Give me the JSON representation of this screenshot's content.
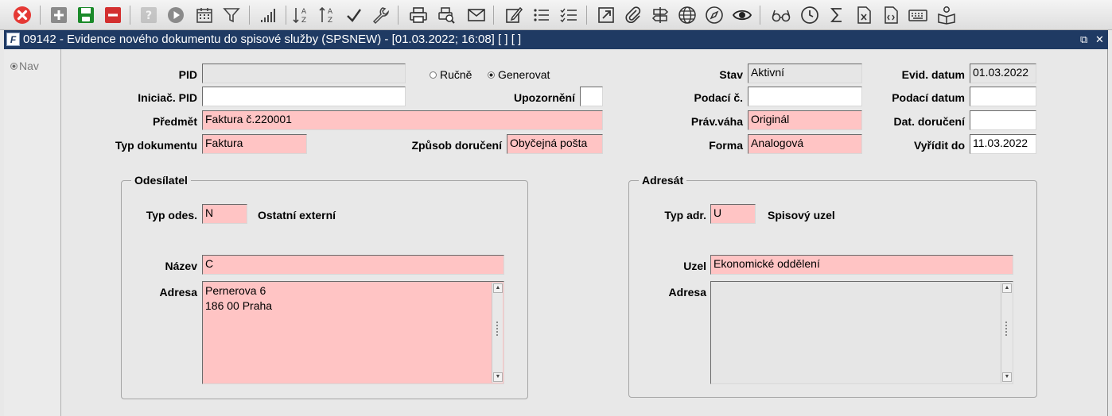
{
  "toolbar": {
    "icons": [
      "close-icon",
      "add-icon",
      "save-icon",
      "delete-icon",
      "help-icon",
      "play-icon",
      "calendar-icon",
      "filter-icon",
      "chart-icon",
      "sort-asc-icon",
      "sort-desc-icon",
      "check-icon",
      "wrench-icon",
      "print-icon",
      "print-preview-icon",
      "mail-icon",
      "edit-icon",
      "list-icon",
      "checklist-icon",
      "export-icon",
      "attach-icon",
      "signpost-icon",
      "globe-icon",
      "compass-icon",
      "eye-icon",
      "glasses-icon",
      "clock-icon",
      "sum-icon",
      "excel-icon",
      "code-icon",
      "keyboard-icon",
      "reader-icon"
    ],
    "colors": {
      "close": "#e53935",
      "save": "#1b8a2a",
      "delete": "#d32f2f"
    }
  },
  "window": {
    "logo": "F",
    "title": "09142 - Evidence nového dokumentu do spisové služby (SPSNEW) - [01.03.2022; 16:08]  [ ]  [ ]",
    "restore_glyph": "⧉",
    "close_glyph": "✕",
    "title_bg": "#1f3a63"
  },
  "nav": {
    "label": "Nav"
  },
  "form": {
    "pid": {
      "label": "PID",
      "value": ""
    },
    "init_pid": {
      "label": "Iniciač. PID",
      "value": ""
    },
    "predmet": {
      "label": "Předmět",
      "value": "Faktura č.220001"
    },
    "typ_dok": {
      "label": "Typ dokumentu",
      "value": "Faktura"
    },
    "mode": {
      "manual": "Ručně",
      "generate": "Generovat",
      "selected": "generate"
    },
    "upozorneni": {
      "label": "Upozornění",
      "value": ""
    },
    "zpusob": {
      "label": "Způsob doručení",
      "value": "Obyčejná pošta"
    },
    "stav": {
      "label": "Stav",
      "value": "Aktivní"
    },
    "podaci_c": {
      "label": "Podací č.",
      "value": ""
    },
    "prav_vaha": {
      "label": "Práv.váha",
      "value": "Originál"
    },
    "forma": {
      "label": "Forma",
      "value": "Analogová"
    },
    "evid_datum": {
      "label": "Evid. datum",
      "value": "01.03.2022"
    },
    "podaci_datum": {
      "label": "Podací datum",
      "value": ""
    },
    "dat_doruceni": {
      "label": "Dat. doručení",
      "value": ""
    },
    "vyridit_do": {
      "label": "Vyřídit do",
      "value": "11.03.2022"
    }
  },
  "sender": {
    "title": "Odesílatel",
    "type_label": "Typ odes.",
    "type_value": "N",
    "type_desc": "Ostatní externí",
    "name_label": "Název",
    "name_value": "C",
    "address_label": "Adresa",
    "address_value": "Pernerova 6\n186 00 Praha"
  },
  "recipient": {
    "title": "Adresát",
    "type_label": "Typ adr.",
    "type_value": "U",
    "type_desc": "Spisový uzel",
    "node_label": "Uzel",
    "node_value": "Ekonomické oddělení",
    "address_label": "Adresa",
    "address_value": ""
  }
}
